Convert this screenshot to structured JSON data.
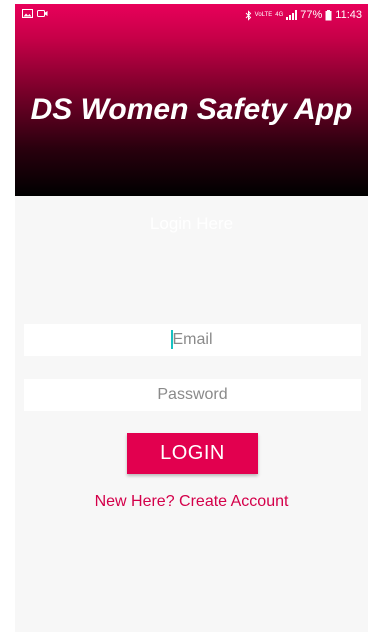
{
  "status_bar": {
    "battery": "77%",
    "time": "11:43",
    "volte_label": "VoLTE",
    "network_label": "4G"
  },
  "header": {
    "title": "DS Women Safety App"
  },
  "form": {
    "heading": "Login Here",
    "email_placeholder": "Email",
    "password_placeholder": "Password",
    "login_label": "LOGIN",
    "create_account_label": "New Here? Create Account"
  },
  "colors": {
    "accent": "#e2004f",
    "link": "#d4004a",
    "background": "#f7f7f7"
  }
}
